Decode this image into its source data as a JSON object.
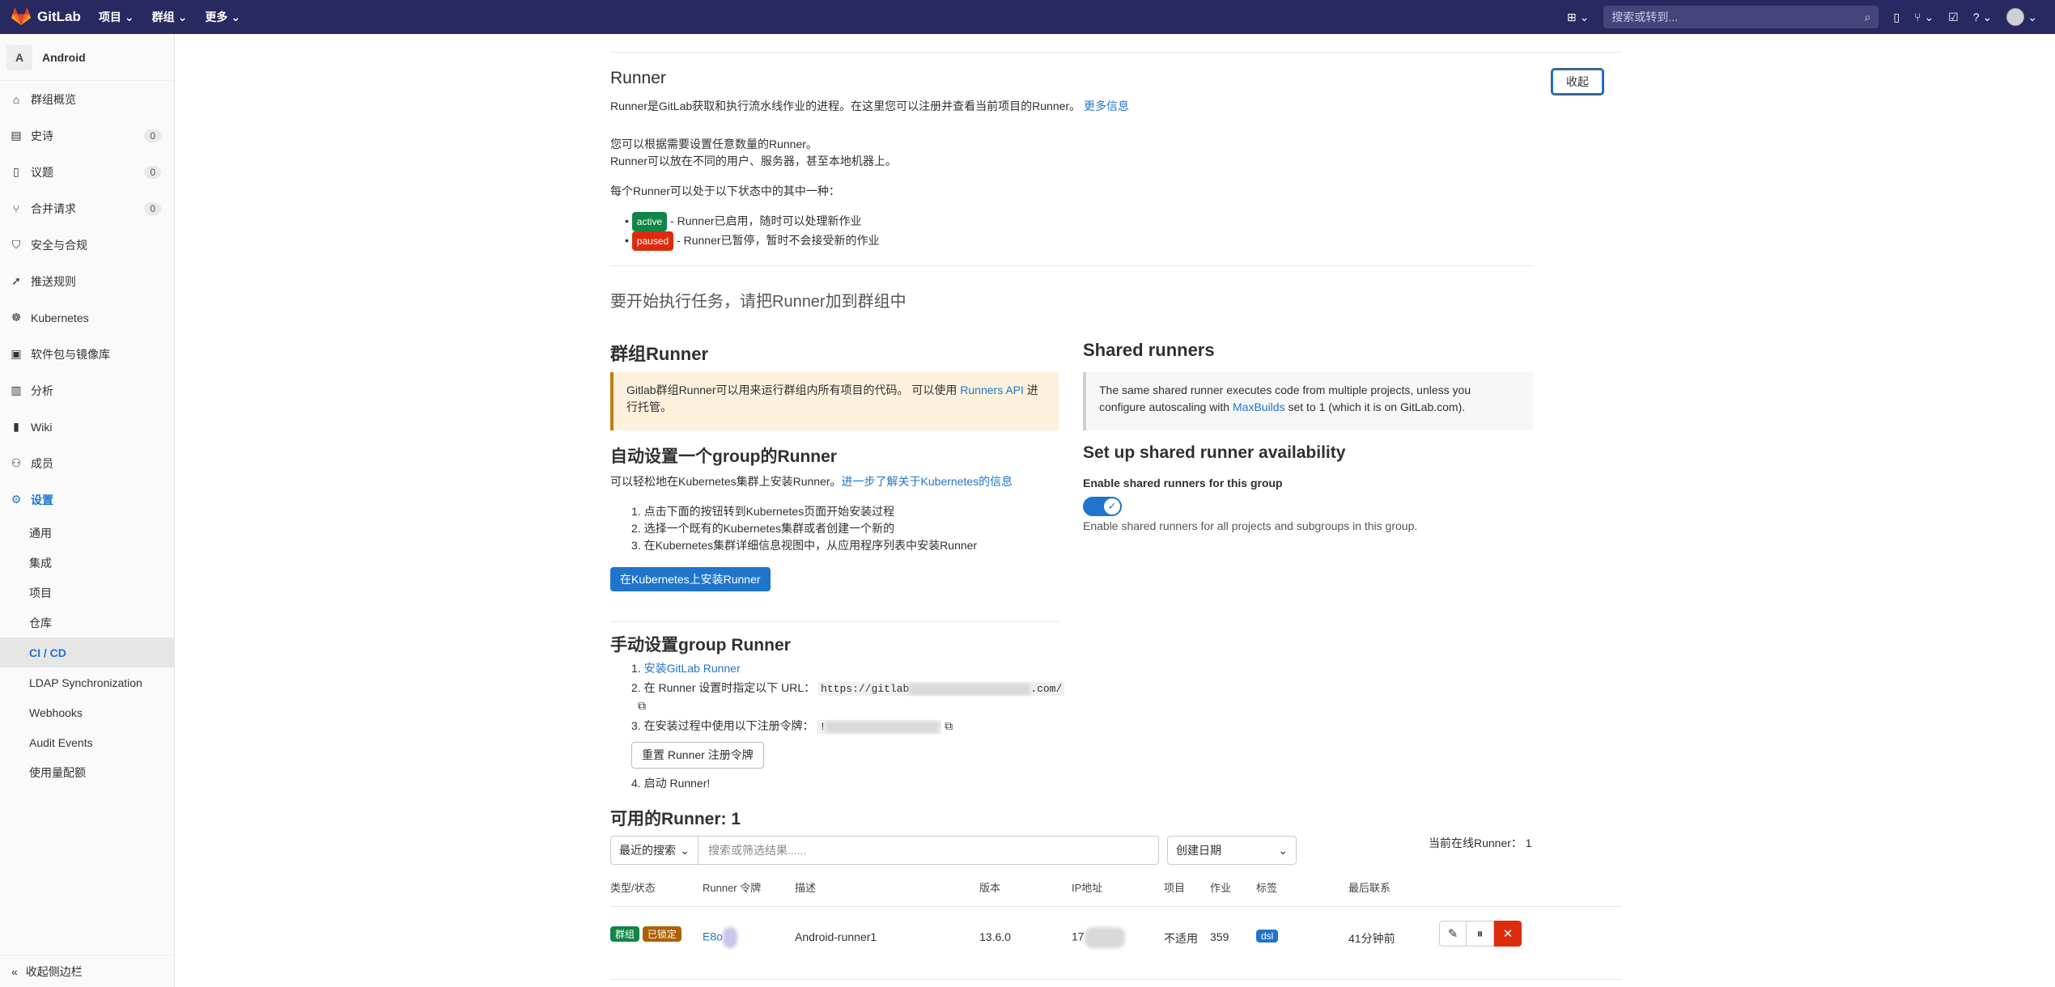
{
  "topbar": {
    "brand": "GitLab",
    "nav": [
      "项目",
      "群组",
      "更多"
    ],
    "search_placeholder": "搜索或转到..."
  },
  "sidebar": {
    "project_initial": "A",
    "project_name": "Android",
    "items": [
      {
        "label": "群组概览",
        "icon": "home-icon"
      },
      {
        "label": "史诗",
        "icon": "epic-icon",
        "count": "0"
      },
      {
        "label": "议题",
        "icon": "issues-icon",
        "count": "0"
      },
      {
        "label": "合并请求",
        "icon": "merge-request-icon",
        "count": "0"
      },
      {
        "label": "安全与合规",
        "icon": "shield-icon"
      },
      {
        "label": "推送规则",
        "icon": "push-rules-icon"
      },
      {
        "label": "Kubernetes",
        "icon": "kubernetes-icon"
      },
      {
        "label": "软件包与镜像库",
        "icon": "package-icon"
      },
      {
        "label": "分析",
        "icon": "chart-icon"
      },
      {
        "label": "Wiki",
        "icon": "book-icon"
      },
      {
        "label": "成员",
        "icon": "users-icon"
      },
      {
        "label": "设置",
        "icon": "gear-icon"
      }
    ],
    "sub_items": [
      "通用",
      "集成",
      "项目",
      "仓库",
      "CI / CD",
      "LDAP Synchronization",
      "Webhooks",
      "Audit Events",
      "使用量配额"
    ],
    "collapse_label": "收起侧边栏"
  },
  "runner_section": {
    "title": "Runner",
    "collapse_button": "收起",
    "intro": "Runner是GitLab获取和执行流水线作业的进程。在这里您可以注册并查看当前项目的Runner。",
    "more_info": "更多信息",
    "line1": "您可以根据需要设置任意数量的Runner。",
    "line2": "Runner可以放在不同的用户、服务器，甚至本地机器上。",
    "states_intro": "每个Runner可以处于以下状态中的其中一种：",
    "active_badge": "active",
    "active_text": "- Runner已启用，随时可以处理新作业",
    "paused_badge": "paused",
    "paused_text": "- Runner已暂停，暂时不会接受新的作业",
    "start_heading": "要开始执行任务，请把Runner加到群组中"
  },
  "group_runner": {
    "title": "群组Runner",
    "alert_text": "Gitlab群组Runner可以用来运行群组内所有项目的代码。 可以使用",
    "alert_link": "Runners API",
    "alert_text2": "进",
    "alert_text3": "行托管。",
    "auto_title": "自动设置一个group的Runner",
    "auto_desc": "可以轻松地在Kubernetes集群上安装Runner。",
    "auto_link": "进一步了解关于Kubernetes的信息",
    "steps": [
      "1. 点击下面的按钮转到Kubernetes页面开始安装过程",
      "2. 选择一个既有的Kubernetes集群或者创建一个新的",
      "3. 在Kubernetes集群详细信息视图中，从应用程序列表中安装Runner"
    ],
    "install_button": "在Kubernetes上安装Runner",
    "manual_title": "手动设置group Runner",
    "manual_step1_num": "1.",
    "manual_step1_link": "安装GitLab Runner",
    "manual_step2": "2. 在 Runner 设置时指定以下 URL：",
    "url_start": "https://gitlab",
    "url_end": ".com/",
    "manual_step3": "3. 在安装过程中使用以下注册令牌：",
    "token_start": "!",
    "reset_button": "重置 Runner 注册令牌",
    "manual_step4": "4. 启动 Runner!"
  },
  "shared_runners": {
    "title": "Shared runners",
    "alert_text": "The same shared runner executes code from multiple projects, unless you",
    "alert_text2": "configure autoscaling with",
    "alert_link": "MaxBuilds",
    "alert_text3": "set to 1 (which it is on GitLab.com).",
    "setup_title": "Set up shared runner availability",
    "enable_label": "Enable shared runners for this group",
    "enable_desc": "Enable shared runners for all projects and subgroups in this group.",
    "toggle_on": true
  },
  "available": {
    "title": "可用的Runner: 1",
    "recent_search": "最近的搜索",
    "search_placeholder": "搜索或筛选结果......",
    "sort": "创建日期",
    "online": "当前在线Runner： 1",
    "columns": [
      "类型/状态",
      "Runner 令牌",
      "描述",
      "版本",
      "IP地址",
      "项目",
      "作业",
      "标签",
      "最后联系"
    ],
    "row": {
      "type_badge": "群组",
      "locked_badge": "已锁定",
      "token": "E8o",
      "description": "Android-runner1",
      "version": "13.6.0",
      "ip": "17",
      "projects": "不适用",
      "jobs": "359",
      "tag": "dsl",
      "last_contact": "41分钟前"
    }
  },
  "colors": {
    "topbar": "#292961",
    "link": "#1f75cb",
    "active": "#108548",
    "paused": "#dd2b0e",
    "locked": "#ab6100",
    "danger": "#dd2b0e"
  }
}
